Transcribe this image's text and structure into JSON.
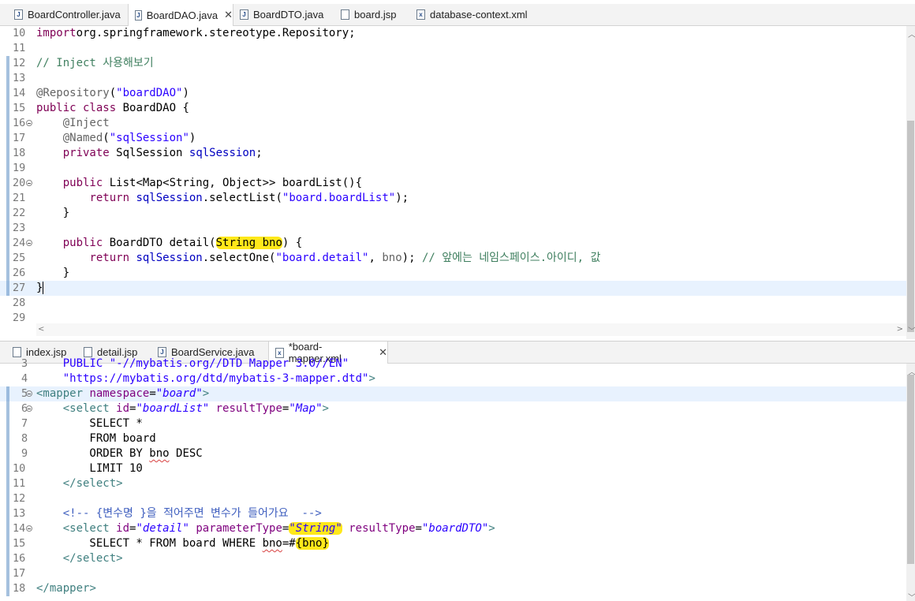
{
  "top_pane": {
    "tabs": [
      {
        "label": "BoardController.java",
        "icon": "java-file-icon"
      },
      {
        "label": "BoardDAO.java",
        "icon": "java-file-icon",
        "active": true,
        "close": "✕"
      },
      {
        "label": "BoardDTO.java",
        "icon": "java-file-icon"
      },
      {
        "label": "board.jsp",
        "icon": "jsp-file-icon"
      },
      {
        "label": "database-context.xml",
        "icon": "xml-file-icon"
      }
    ],
    "lines": [
      {
        "n": "10",
        "segs": [
          [
            "kw",
            "import"
          ],
          [
            "",
            "org.springframework.stereotype.Repository;"
          ]
        ]
      },
      {
        "n": "11",
        "segs": []
      },
      {
        "n": "12",
        "segs": [
          [
            "cm",
            "// Inject 사용해보기"
          ]
        ]
      },
      {
        "n": "13",
        "segs": []
      },
      {
        "n": "14",
        "segs": [
          [
            "ann",
            "@Repository"
          ],
          [
            "",
            "("
          ],
          [
            "str",
            "\"boardDAO\""
          ],
          [
            "",
            ")"
          ]
        ]
      },
      {
        "n": "15",
        "segs": [
          [
            "kw",
            "public class"
          ],
          [
            "",
            " BoardDAO "
          ],
          [
            "",
            "{"
          ]
        ]
      },
      {
        "n": "16",
        "segs": [
          [
            "",
            "    "
          ],
          [
            "ann",
            "@Inject"
          ]
        ]
      },
      {
        "n": "17",
        "segs": [
          [
            "",
            "    "
          ],
          [
            "ann",
            "@Named"
          ],
          [
            "",
            "("
          ],
          [
            "str",
            "\"sqlSession\""
          ],
          [
            "",
            ")"
          ]
        ]
      },
      {
        "n": "18",
        "segs": [
          [
            "",
            "    "
          ],
          [
            "kw",
            "private"
          ],
          [
            "",
            " SqlSession "
          ],
          [
            "fld",
            "sqlSession"
          ],
          [
            "",
            ";"
          ]
        ]
      },
      {
        "n": "19",
        "segs": []
      },
      {
        "n": "20",
        "segs": [
          [
            "",
            "    "
          ],
          [
            "kw",
            "public"
          ],
          [
            "",
            " List<Map<String, Object>> boardList(){"
          ]
        ]
      },
      {
        "n": "21",
        "segs": [
          [
            "",
            "        "
          ],
          [
            "kw",
            "return"
          ],
          [
            "",
            " "
          ],
          [
            "fld",
            "sqlSession"
          ],
          [
            "",
            ".selectList("
          ],
          [
            "str",
            "\"board.boardList\""
          ],
          [
            "",
            ");"
          ]
        ]
      },
      {
        "n": "22",
        "segs": [
          [
            "",
            "    }"
          ]
        ]
      },
      {
        "n": "23",
        "segs": []
      },
      {
        "n": "24",
        "segs": [
          [
            "",
            "    "
          ],
          [
            "kw",
            "public"
          ],
          [
            "",
            " BoardDTO detail("
          ],
          [
            "hl",
            "String bno"
          ],
          [
            "",
            ") {"
          ]
        ]
      },
      {
        "n": "25",
        "segs": [
          [
            "",
            "        "
          ],
          [
            "kw",
            "return"
          ],
          [
            "",
            " "
          ],
          [
            "fld",
            "sqlSession"
          ],
          [
            "",
            ".selectOne("
          ],
          [
            "str",
            "\"board.detail\""
          ],
          [
            "",
            ", "
          ],
          [
            "ann",
            "bno"
          ],
          [
            "",
            "); "
          ],
          [
            "cm",
            "// 앞에는 네임스페이스.아이디, 값"
          ]
        ]
      },
      {
        "n": "26",
        "segs": [
          [
            "",
            "    }"
          ]
        ]
      },
      {
        "n": "27",
        "segs": [
          [
            "",
            "}"
          ]
        ]
      },
      {
        "n": "28",
        "segs": []
      },
      {
        "n": "29",
        "segs": []
      }
    ]
  },
  "bottom_pane": {
    "tabs": [
      {
        "label": "index.jsp",
        "icon": "jsp-file-icon"
      },
      {
        "label": "detail.jsp",
        "icon": "jsp-file-icon"
      },
      {
        "label": "BoardService.java",
        "icon": "java-file-icon"
      },
      {
        "label": "*board-mapper.xml",
        "icon": "xml-file-icon",
        "active": true,
        "close": "✕"
      }
    ],
    "lines": [
      {
        "n": "3",
        "segs": [
          [
            "str",
            "    PUBLIC \"-//mybatis.org//DTD Mapper 3.0//EN\""
          ]
        ]
      },
      {
        "n": "4",
        "segs": [
          [
            "str",
            "    \"https://mybatis.org/dtd/mybatis-3-mapper.dtd\""
          ],
          [
            "tag",
            ">"
          ]
        ]
      },
      {
        "n": "5",
        "segs": [
          [
            "tag",
            "<mapper"
          ],
          [
            "",
            " "
          ],
          [
            "attr",
            "namespace"
          ],
          [
            "",
            "="
          ],
          [
            "aval",
            "\"board\""
          ],
          [
            "tag",
            ">"
          ]
        ]
      },
      {
        "n": "6",
        "segs": [
          [
            "",
            "    "
          ],
          [
            "tag",
            "<select"
          ],
          [
            "",
            " "
          ],
          [
            "attr",
            "id"
          ],
          [
            "",
            "="
          ],
          [
            "aval",
            "\"boardList\""
          ],
          [
            "",
            " "
          ],
          [
            "attr",
            "resultType"
          ],
          [
            "",
            "="
          ],
          [
            "aval",
            "\"Map\""
          ],
          [
            "tag",
            ">"
          ]
        ]
      },
      {
        "n": "7",
        "segs": [
          [
            "",
            "        SELECT *"
          ]
        ]
      },
      {
        "n": "8",
        "segs": [
          [
            "",
            "        FROM board"
          ]
        ]
      },
      {
        "n": "9",
        "segs": [
          [
            "",
            "        ORDER BY "
          ],
          [
            "sq",
            "bno"
          ],
          [
            "",
            " DESC"
          ]
        ]
      },
      {
        "n": "10",
        "segs": [
          [
            "",
            "        LIMIT 10"
          ]
        ]
      },
      {
        "n": "11",
        "segs": [
          [
            "",
            "    "
          ],
          [
            "tag",
            "</select>"
          ]
        ]
      },
      {
        "n": "12",
        "segs": []
      },
      {
        "n": "13",
        "segs": [
          [
            "",
            "    "
          ],
          [
            "cmk",
            "<!-- {변수명 }을 적어주면 변수가 들어가요  -->"
          ]
        ]
      },
      {
        "n": "14",
        "segs": [
          [
            "",
            "    "
          ],
          [
            "tag",
            "<select"
          ],
          [
            "",
            " "
          ],
          [
            "attr",
            "id"
          ],
          [
            "",
            "="
          ],
          [
            "aval",
            "\"detail\""
          ],
          [
            "",
            " "
          ],
          [
            "attr",
            "parameterType"
          ],
          [
            "",
            "="
          ],
          [
            "hlaval",
            "\"String\""
          ],
          [
            "",
            " "
          ],
          [
            "attr",
            "resultType"
          ],
          [
            "",
            "="
          ],
          [
            "aval",
            "\"boardDTO\""
          ],
          [
            "tag",
            ">"
          ]
        ]
      },
      {
        "n": "15",
        "segs": [
          [
            "",
            "        SELECT * FROM board WHERE "
          ],
          [
            "sq",
            "bno"
          ],
          [
            "",
            "=#"
          ],
          [
            "hl",
            "{bno}"
          ]
        ]
      },
      {
        "n": "16",
        "segs": [
          [
            "",
            "    "
          ],
          [
            "tag",
            "</select>"
          ]
        ]
      },
      {
        "n": "17",
        "segs": []
      },
      {
        "n": "18",
        "segs": [
          [
            "tag",
            "</"
          ],
          [
            "tag",
            "mapper"
          ],
          [
            "tag",
            ">"
          ]
        ]
      }
    ]
  }
}
